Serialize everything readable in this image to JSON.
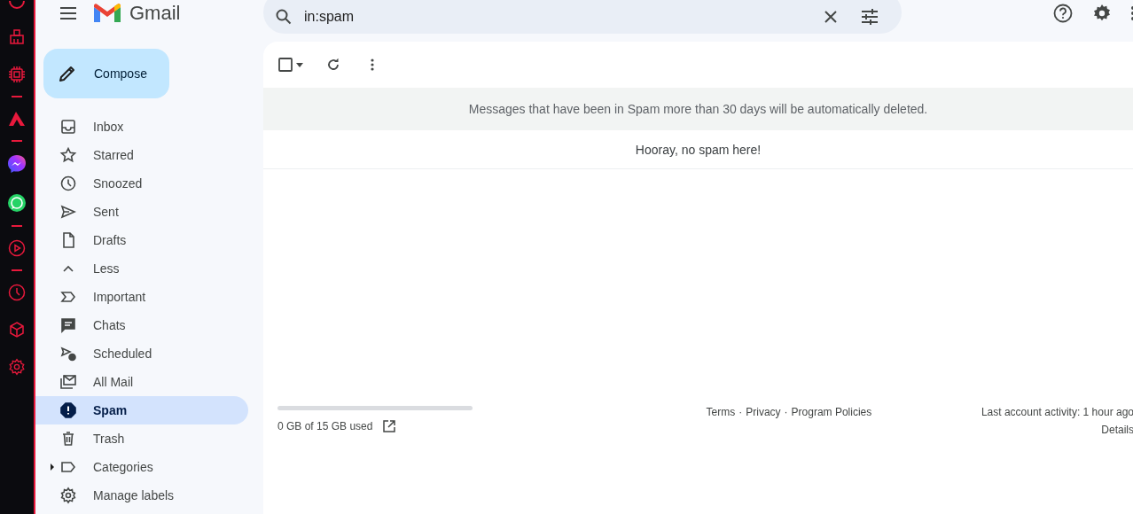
{
  "app": {
    "name": "Gmail"
  },
  "compose": {
    "label": "Compose"
  },
  "sidebar": {
    "items": [
      {
        "label": "Inbox",
        "kind": "folder",
        "selected": false
      },
      {
        "label": "Starred",
        "kind": "folder",
        "selected": false
      },
      {
        "label": "Snoozed",
        "kind": "folder",
        "selected": false
      },
      {
        "label": "Sent",
        "kind": "folder",
        "selected": false
      },
      {
        "label": "Drafts",
        "kind": "folder",
        "selected": false
      },
      {
        "label": "Less",
        "kind": "toggle",
        "selected": false
      },
      {
        "label": "Important",
        "kind": "folder",
        "selected": false
      },
      {
        "label": "Chats",
        "kind": "folder",
        "selected": false
      },
      {
        "label": "Scheduled",
        "kind": "folder",
        "selected": false
      },
      {
        "label": "All Mail",
        "kind": "folder",
        "selected": false
      },
      {
        "label": "Spam",
        "kind": "folder",
        "selected": true
      },
      {
        "label": "Trash",
        "kind": "folder",
        "selected": false
      },
      {
        "label": "Categories",
        "kind": "group",
        "expanded": false,
        "selected": false
      },
      {
        "label": "Manage labels",
        "kind": "folder",
        "selected": false
      }
    ]
  },
  "search": {
    "value": "in:spam"
  },
  "toolbar": {
    "select_all": {
      "checked": false
    }
  },
  "banner": {
    "text": "Messages that have been in Spam more than 30 days will be automatically deleted."
  },
  "empty_message": "Hooray, no spam here!",
  "footer": {
    "storage": {
      "level": 0,
      "text": "0 GB of 15 GB used"
    },
    "links": [
      "Terms",
      "Privacy",
      "Program Policies"
    ],
    "separator": "·",
    "activity": "Last account activity: 1 hour ago",
    "details": "Details"
  }
}
